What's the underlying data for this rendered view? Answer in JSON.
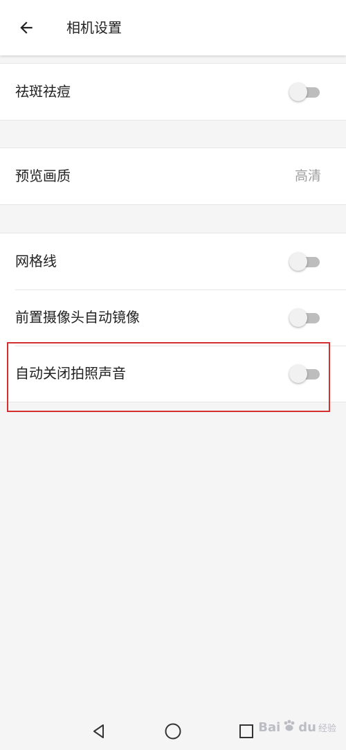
{
  "header": {
    "title": "相机设置",
    "back_icon": "arrow-left-icon"
  },
  "groups": [
    {
      "rows": [
        {
          "label": "祛斑祛痘",
          "control": "switch",
          "checked": false
        }
      ]
    },
    {
      "rows": [
        {
          "label": "预览画质",
          "control": "value",
          "value": "高清"
        }
      ]
    },
    {
      "rows": [
        {
          "label": "网格线",
          "control": "switch",
          "checked": false
        },
        {
          "label": "前置摄像头自动镜像",
          "control": "switch",
          "checked": false
        },
        {
          "label": "自动关闭拍照声音",
          "control": "switch",
          "checked": false
        }
      ]
    }
  ],
  "navbar": {
    "back_icon": "triangle-back-icon",
    "home_icon": "circle-home-icon",
    "recents_icon": "square-recents-icon"
  },
  "watermark": {
    "text_left": "Bai",
    "text_right": "du",
    "sub": "经验"
  },
  "colors": {
    "highlight": "#d32f2f",
    "switch_off_track": "#bdbdbd",
    "switch_off_thumb": "#f1f1f1",
    "background": "#f5f5f5"
  }
}
